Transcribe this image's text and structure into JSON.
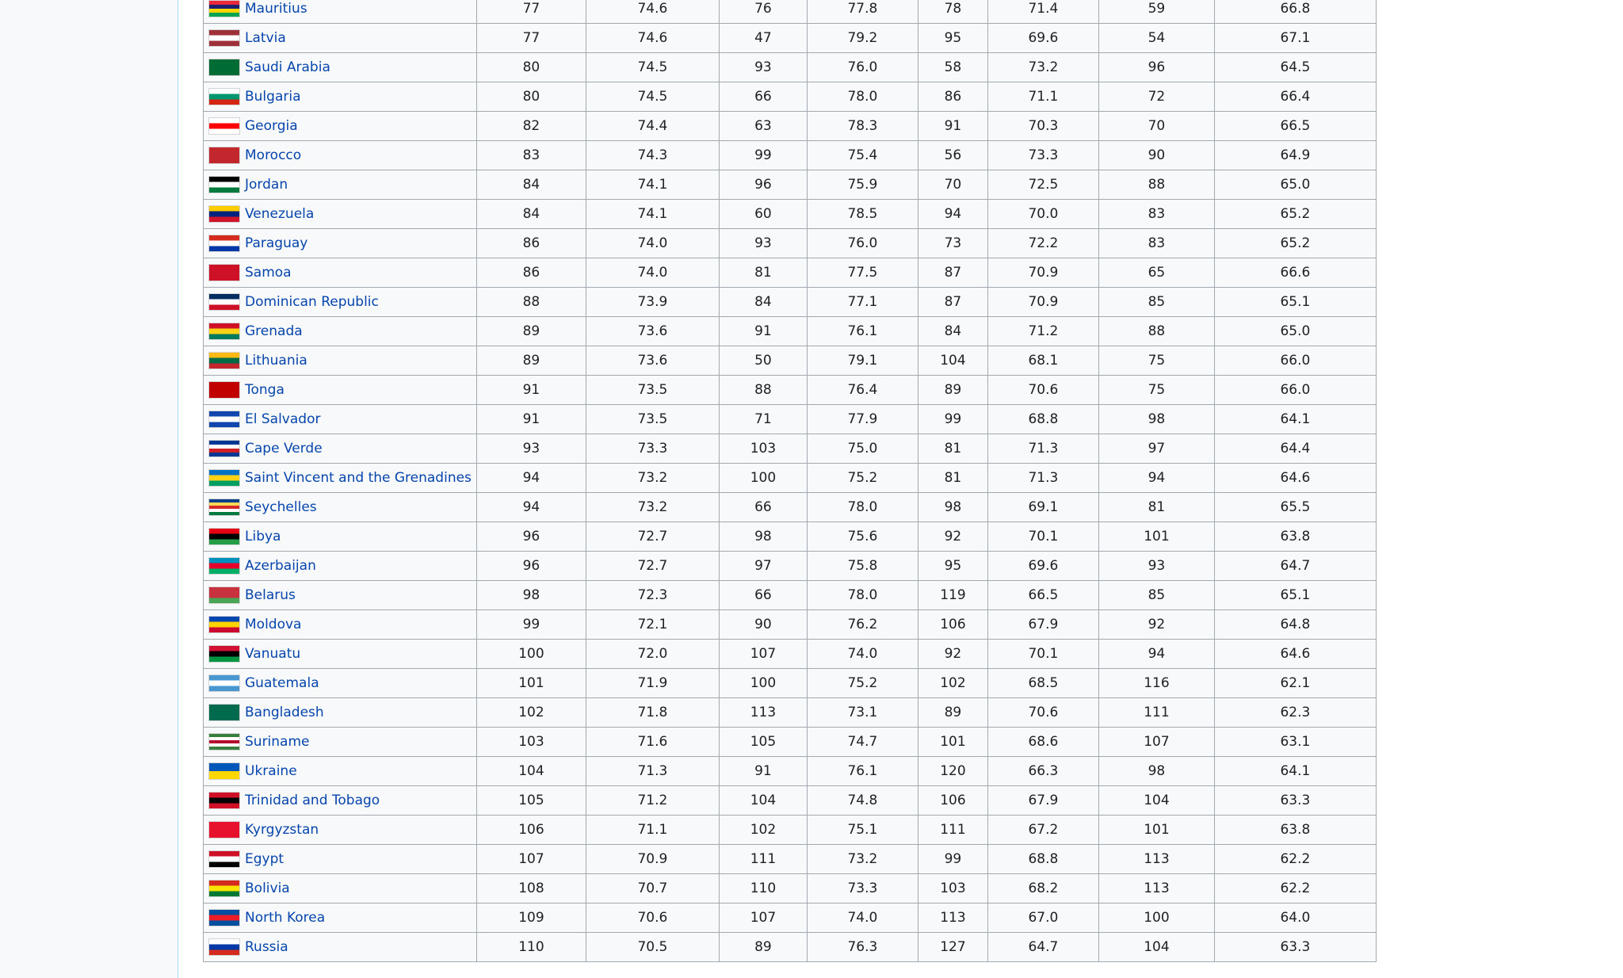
{
  "rows": [
    {
      "country": "Mauritius",
      "flag": [
        "#ea2839",
        "#1a206d",
        "#ffd500",
        "#00a551"
      ],
      "v": [
        "77",
        "74.6",
        "76",
        "77.8",
        "78",
        "71.4",
        "59",
        "66.8"
      ]
    },
    {
      "country": "Latvia",
      "flag": [
        "#9e3039",
        "#ffffff",
        "#9e3039"
      ],
      "v": [
        "77",
        "74.6",
        "47",
        "79.2",
        "95",
        "69.6",
        "54",
        "67.1"
      ]
    },
    {
      "country": "Saudi Arabia",
      "flag": [
        "#006c35"
      ],
      "v": [
        "80",
        "74.5",
        "93",
        "76.0",
        "58",
        "73.2",
        "96",
        "64.5"
      ]
    },
    {
      "country": "Bulgaria",
      "flag": [
        "#ffffff",
        "#00966e",
        "#d62612"
      ],
      "v": [
        "80",
        "74.5",
        "66",
        "78.0",
        "86",
        "71.1",
        "72",
        "66.4"
      ]
    },
    {
      "country": "Georgia",
      "flag": [
        "#ffffff",
        "#ff0000",
        "#ffffff"
      ],
      "v": [
        "82",
        "74.4",
        "63",
        "78.3",
        "91",
        "70.3",
        "70",
        "66.5"
      ]
    },
    {
      "country": "Morocco",
      "flag": [
        "#c1272d"
      ],
      "v": [
        "83",
        "74.3",
        "99",
        "75.4",
        "56",
        "73.3",
        "90",
        "64.9"
      ]
    },
    {
      "country": "Jordan",
      "flag": [
        "#000000",
        "#ffffff",
        "#007a3d"
      ],
      "v": [
        "84",
        "74.1",
        "96",
        "75.9",
        "70",
        "72.5",
        "88",
        "65.0"
      ]
    },
    {
      "country": "Venezuela",
      "flag": [
        "#ffcc00",
        "#00247d",
        "#cf142b"
      ],
      "v": [
        "84",
        "74.1",
        "60",
        "78.5",
        "94",
        "70.0",
        "83",
        "65.2"
      ]
    },
    {
      "country": "Paraguay",
      "flag": [
        "#d52b1e",
        "#ffffff",
        "#0038a8"
      ],
      "v": [
        "86",
        "74.0",
        "93",
        "76.0",
        "73",
        "72.2",
        "83",
        "65.2"
      ]
    },
    {
      "country": "Samoa",
      "flag": [
        "#ce1126"
      ],
      "v": [
        "86",
        "74.0",
        "81",
        "77.5",
        "87",
        "70.9",
        "65",
        "66.6"
      ]
    },
    {
      "country": "Dominican Republic",
      "flag": [
        "#002d62",
        "#ffffff",
        "#ce1126"
      ],
      "v": [
        "88",
        "73.9",
        "84",
        "77.1",
        "87",
        "70.9",
        "85",
        "65.1"
      ]
    },
    {
      "country": "Grenada",
      "flag": [
        "#ce1126",
        "#fcd116",
        "#007a5e"
      ],
      "v": [
        "89",
        "73.6",
        "91",
        "76.1",
        "84",
        "71.2",
        "88",
        "65.0"
      ]
    },
    {
      "country": "Lithuania",
      "flag": [
        "#fdb913",
        "#006a44",
        "#c1272d"
      ],
      "v": [
        "89",
        "73.6",
        "50",
        "79.1",
        "104",
        "68.1",
        "75",
        "66.0"
      ]
    },
    {
      "country": "Tonga",
      "flag": [
        "#c10000"
      ],
      "v": [
        "91",
        "73.5",
        "88",
        "76.4",
        "89",
        "70.6",
        "75",
        "66.0"
      ]
    },
    {
      "country": "El Salvador",
      "flag": [
        "#0f47af",
        "#ffffff",
        "#0f47af"
      ],
      "v": [
        "91",
        "73.5",
        "71",
        "77.9",
        "99",
        "68.8",
        "98",
        "64.1"
      ]
    },
    {
      "country": "Cape Verde",
      "flag": [
        "#003893",
        "#ffffff",
        "#cf2027",
        "#003893"
      ],
      "v": [
        "93",
        "73.3",
        "103",
        "75.0",
        "81",
        "71.3",
        "97",
        "64.4"
      ]
    },
    {
      "country": "Saint Vincent and the Grenadines",
      "flag": [
        "#0072c6",
        "#fcd116",
        "#009e60"
      ],
      "v": [
        "94",
        "73.2",
        "100",
        "75.2",
        "81",
        "71.3",
        "94",
        "64.6"
      ]
    },
    {
      "country": "Seychelles",
      "flag": [
        "#003f87",
        "#fcd856",
        "#d62828",
        "#ffffff",
        "#007a3d"
      ],
      "v": [
        "94",
        "73.2",
        "66",
        "78.0",
        "98",
        "69.1",
        "81",
        "65.5"
      ]
    },
    {
      "country": "Libya",
      "flag": [
        "#e70013",
        "#000000",
        "#239e46"
      ],
      "v": [
        "96",
        "72.7",
        "98",
        "75.6",
        "92",
        "70.1",
        "101",
        "63.8"
      ]
    },
    {
      "country": "Azerbaijan",
      "flag": [
        "#0092bc",
        "#e4002b",
        "#00af66"
      ],
      "v": [
        "96",
        "72.7",
        "97",
        "75.8",
        "95",
        "69.6",
        "93",
        "64.7"
      ]
    },
    {
      "country": "Belarus",
      "flag": [
        "#c8313e",
        "#c8313e",
        "#4aa657"
      ],
      "v": [
        "98",
        "72.3",
        "66",
        "78.0",
        "119",
        "66.5",
        "85",
        "65.1"
      ]
    },
    {
      "country": "Moldova",
      "flag": [
        "#0046ae",
        "#ffd200",
        "#cc092f"
      ],
      "v": [
        "99",
        "72.1",
        "90",
        "76.2",
        "106",
        "67.9",
        "92",
        "64.8"
      ]
    },
    {
      "country": "Vanuatu",
      "flag": [
        "#d21034",
        "#000000",
        "#009543"
      ],
      "v": [
        "100",
        "72.0",
        "107",
        "74.0",
        "92",
        "70.1",
        "94",
        "64.6"
      ]
    },
    {
      "country": "Guatemala",
      "flag": [
        "#4997d0",
        "#ffffff",
        "#4997d0"
      ],
      "v": [
        "101",
        "71.9",
        "100",
        "75.2",
        "102",
        "68.5",
        "116",
        "62.1"
      ]
    },
    {
      "country": "Bangladesh",
      "flag": [
        "#006a4e"
      ],
      "v": [
        "102",
        "71.8",
        "113",
        "73.1",
        "89",
        "70.6",
        "111",
        "62.3"
      ]
    },
    {
      "country": "Suriname",
      "flag": [
        "#377e3f",
        "#ffffff",
        "#b40a2d",
        "#ffffff",
        "#377e3f"
      ],
      "v": [
        "103",
        "71.6",
        "105",
        "74.7",
        "101",
        "68.6",
        "107",
        "63.1"
      ]
    },
    {
      "country": "Ukraine",
      "flag": [
        "#0057b7",
        "#ffd700"
      ],
      "v": [
        "104",
        "71.3",
        "91",
        "76.1",
        "120",
        "66.3",
        "98",
        "64.1"
      ]
    },
    {
      "country": "Trinidad and Tobago",
      "flag": [
        "#ce1126",
        "#000000",
        "#ce1126"
      ],
      "v": [
        "105",
        "71.2",
        "104",
        "74.8",
        "106",
        "67.9",
        "104",
        "63.3"
      ]
    },
    {
      "country": "Kyrgyzstan",
      "flag": [
        "#e8112d"
      ],
      "v": [
        "106",
        "71.1",
        "102",
        "75.1",
        "111",
        "67.2",
        "101",
        "63.8"
      ]
    },
    {
      "country": "Egypt",
      "flag": [
        "#ce1126",
        "#ffffff",
        "#000000"
      ],
      "v": [
        "107",
        "70.9",
        "111",
        "73.2",
        "99",
        "68.8",
        "113",
        "62.2"
      ]
    },
    {
      "country": "Bolivia",
      "flag": [
        "#d52b1e",
        "#f9e300",
        "#007934"
      ],
      "v": [
        "108",
        "70.7",
        "110",
        "73.3",
        "103",
        "68.2",
        "113",
        "62.2"
      ]
    },
    {
      "country": "North Korea",
      "flag": [
        "#024fa2",
        "#ed1c27",
        "#024fa2"
      ],
      "v": [
        "109",
        "70.6",
        "107",
        "74.0",
        "113",
        "67.0",
        "100",
        "64.0"
      ]
    },
    {
      "country": "Russia",
      "flag": [
        "#ffffff",
        "#0039a6",
        "#d52b1e"
      ],
      "v": [
        "110",
        "70.5",
        "89",
        "76.3",
        "127",
        "64.7",
        "104",
        "63.3"
      ]
    }
  ]
}
